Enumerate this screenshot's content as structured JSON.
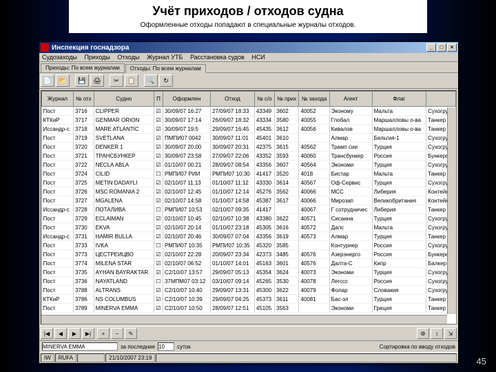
{
  "slide": {
    "title": "Учёт приходов / отходов судна",
    "subtitle": "Оформленные отходы попадают в специальные журналы отходов.",
    "page_num": "45"
  },
  "window": {
    "title": "Инспекция госнадзора",
    "winbtns": {
      "min": "_",
      "max": "□",
      "close": "×"
    }
  },
  "menubar": [
    "Судозаходы",
    "Приходы",
    "Отходы",
    "Журнал УТБ",
    "Расстановка судов",
    "НСИ"
  ],
  "tabs": [
    "Приходы: По всем журналам",
    "Отходы: По всем журналам"
  ],
  "columns": [
    "Журнал",
    "№ отх",
    "Судно",
    "П",
    "Оформлен",
    "Отход",
    "№ с/о",
    "№ прих",
    "№ захода",
    "Агент",
    "Флаг",
    ""
  ],
  "rows": [
    [
      "Пост",
      "3716",
      "CLIPPER",
      "✓",
      "30/09/07 16:27",
      "27/09/07 18:33",
      "43349",
      "3602",
      "40052",
      "Эконому",
      "Мальта",
      "Сухогруз"
    ],
    [
      "КТКиР",
      "3717",
      "GENMAR ORION",
      "✓",
      "30/09/07 17:14",
      "26/09/07 18:32",
      "43334",
      "3580",
      "40055",
      "Глобал",
      "Маршалловы о-ва",
      "Танкер"
    ],
    [
      "Иссандр-с",
      "3718",
      "MARE ATLANTIC",
      "✓",
      "30/09/07 19:5",
      "29/09/07 16:45",
      "45435",
      "3612",
      "40056",
      "Кивалов",
      "Маршалловы о-ва",
      "Танкер"
    ],
    [
      "Пост",
      "3719",
      "SVETLANA",
      "✓",
      "ПМПИ07 0042",
      "30/09/07 11:01",
      "45401",
      "3610",
      "",
      "Алмар",
      "Бельгия-1",
      "Сухогруз"
    ],
    [
      "Пост",
      "3720",
      "DENKER 1",
      "✓",
      "30/09/07 20:00",
      "30/09/07 20:31",
      "42375",
      "3615",
      "40562",
      "Трамп сии",
      "Турция",
      "Сухогруз"
    ],
    [
      "Пост",
      "3721",
      "ТРАНСБУНКЕР",
      "✓",
      "30/09/07 23:58",
      "27/09/07 22:06",
      "43352",
      "3593",
      "40060",
      "Трансбункер",
      "Россия",
      "Бункеров"
    ],
    [
      "Пост",
      "3722",
      "NECLA ABLA",
      "✓",
      "01/10/07 00:21",
      "28/09/07 08:54",
      "43356",
      "3607",
      "40564",
      "Экономи",
      "Турция",
      "Сухогруз"
    ],
    [
      "Пост",
      "3724",
      "CILID",
      "",
      "РМПИ07 РИИ",
      "РМПИ07 10:30",
      "41417",
      "3520",
      "4018",
      "Бистар",
      "Мальта",
      "Танкер"
    ],
    [
      "Пост",
      "3725",
      "METIN DADAYLI",
      "✓",
      "02/10/07 11:13",
      "01/10/07 11:12",
      "43330",
      "3614",
      "40567",
      "Оф-Сервис",
      "Турция",
      "Сухогруз"
    ],
    [
      "Пост",
      "3726",
      "MSC ROMANIA 2",
      "✓",
      "02/10/07 12:45",
      "01/10/07 12:14",
      "45276",
      "3562",
      "40066",
      "МСС",
      "Либерия",
      "Контейне"
    ],
    [
      "Пост",
      "3727",
      "MGALENA",
      "✓",
      "02/10/07 14:58",
      "01/10/07 14:58",
      "45387",
      "3617",
      "40066",
      "Мирозап",
      "Великобритания",
      "Контейне"
    ],
    [
      "Иссандр-с",
      "3728",
      "ПОТАЛИВА",
      "",
      "РМПИ07 10:53",
      "02/10/07 09:35",
      "41417",
      "",
      "40067",
      "Г сотрудничес",
      "Либерия",
      "Танкер"
    ],
    [
      "Пост",
      "3729",
      "ECLAIMAN",
      "✓",
      "02/10/07 10:45",
      "02/10/07 10:38",
      "43380",
      "3622",
      "40571",
      "Cисанна",
      "Турция",
      "Сухогруз"
    ],
    [
      "Пост",
      "3730",
      "EKVA",
      "✓",
      "02/10/07 20:14",
      "01/10/07 23:18",
      "45305",
      "3616",
      "40572",
      "Далс",
      "Мальта",
      "Сухогруз"
    ],
    [
      "Иссандр-с",
      "3731",
      "HAMIR BULLA",
      "✓",
      "02/10/07 20:46",
      "30/09/07 07:04",
      "43356",
      "3619",
      "40573",
      "Алмар",
      "Турция",
      "Танкер"
    ],
    [
      "Пост",
      "3733",
      "IVKA",
      "",
      "РМПИ07 10:35",
      "РМПИ07 10:35",
      "45320",
      "3585",
      "",
      "Контурнер",
      "Россия",
      "Сухогруз"
    ],
    [
      "Пост",
      "3773",
      "ЦЕСТРЕИЦВО",
      "✓",
      "02/10/07 22:28",
      "20/09/07 23:34",
      "42373",
      "3485",
      "40576",
      "Азерэнерго",
      "Россия",
      "Бункеров"
    ],
    [
      "Пост",
      "3774",
      "MILENA STAR",
      "✓",
      "02/10/07 06:52",
      "01/10/07 14:01",
      "45163",
      "3601",
      "40576",
      "Далта-С",
      "Кипр",
      "Балкер"
    ],
    [
      "Пост",
      "3735",
      "AYHAN BAYRAKTAR",
      "✓",
      "С2/10/07 13:57",
      "29/09/07 05:13",
      "45354",
      "3624",
      "40073",
      "Экономи",
      "Турция",
      "Сухогруз"
    ],
    [
      "Пост",
      "3736",
      "NAYATLAND",
      "",
      "37МПМ07 0З:12",
      "03/10/07 09:14",
      "45265",
      "3530",
      "40078",
      "Легссс",
      "Россия",
      "Сухогруз"
    ],
    [
      "Пост",
      "3788",
      "ALTRANS",
      "✓",
      "С2/10/07 10:40",
      "29/09/07 13:31",
      "45300",
      "3622",
      "40079",
      "Фолар",
      "Словакия",
      "Сухогруз"
    ],
    [
      "КТКиР",
      "3786",
      "NS COLUMBUS",
      "✓",
      "С2/10/07 10:39",
      "29/09/07 04:25",
      "45373",
      "3611",
      "40081",
      "Бас-эл",
      "Турция",
      "Танкер"
    ],
    [
      "Пост",
      "3789",
      "MINERVA EMMA",
      "✓",
      "С2/10/07 10:50",
      "28/09/07 12:51",
      "45105",
      "3563",
      "",
      "Экономи",
      "Греция",
      "Танкер"
    ]
  ],
  "search": {
    "vessel": "MINERVA EMMA",
    "label1": "за последние",
    "val1": "10",
    "label2": "суток",
    "sortlabel": "Сортировка по вводу отходов"
  },
  "status": {
    "user": "IW",
    "mode": "RUFA",
    "datetime": "21/10/2007 23:19"
  }
}
